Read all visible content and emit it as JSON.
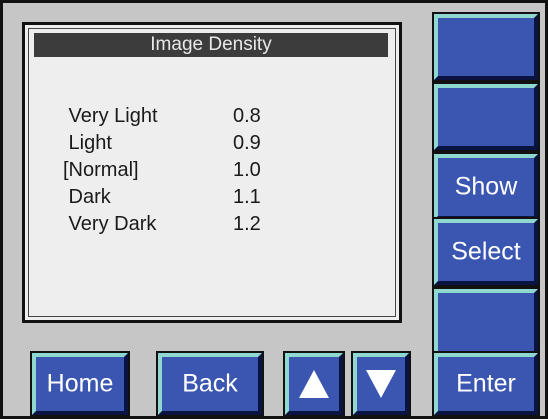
{
  "screen": {
    "title": "Image Density",
    "options": [
      {
        "name": " Very Light",
        "value": "0.8"
      },
      {
        "name": " Light",
        "value": "0.9"
      },
      {
        "name": "[Normal]",
        "value": "1.0"
      },
      {
        "name": " Dark",
        "value": "1.1"
      },
      {
        "name": " Very Dark",
        "value": "1.2"
      }
    ]
  },
  "side_buttons": {
    "blank1": "",
    "blank2": "",
    "show": "Show",
    "select": "Select",
    "blank3": "",
    "enter": "Enter"
  },
  "bottom_buttons": {
    "home": "Home",
    "back": "Back",
    "up": "up-arrow-icon",
    "down": "down-arrow-icon"
  },
  "colors": {
    "panel": "#c6c6c6",
    "screen": "#eeeeee",
    "title_bar": "#3c3c3c",
    "button": "#3a56b0",
    "button_highlight": "#8fd8d0"
  }
}
